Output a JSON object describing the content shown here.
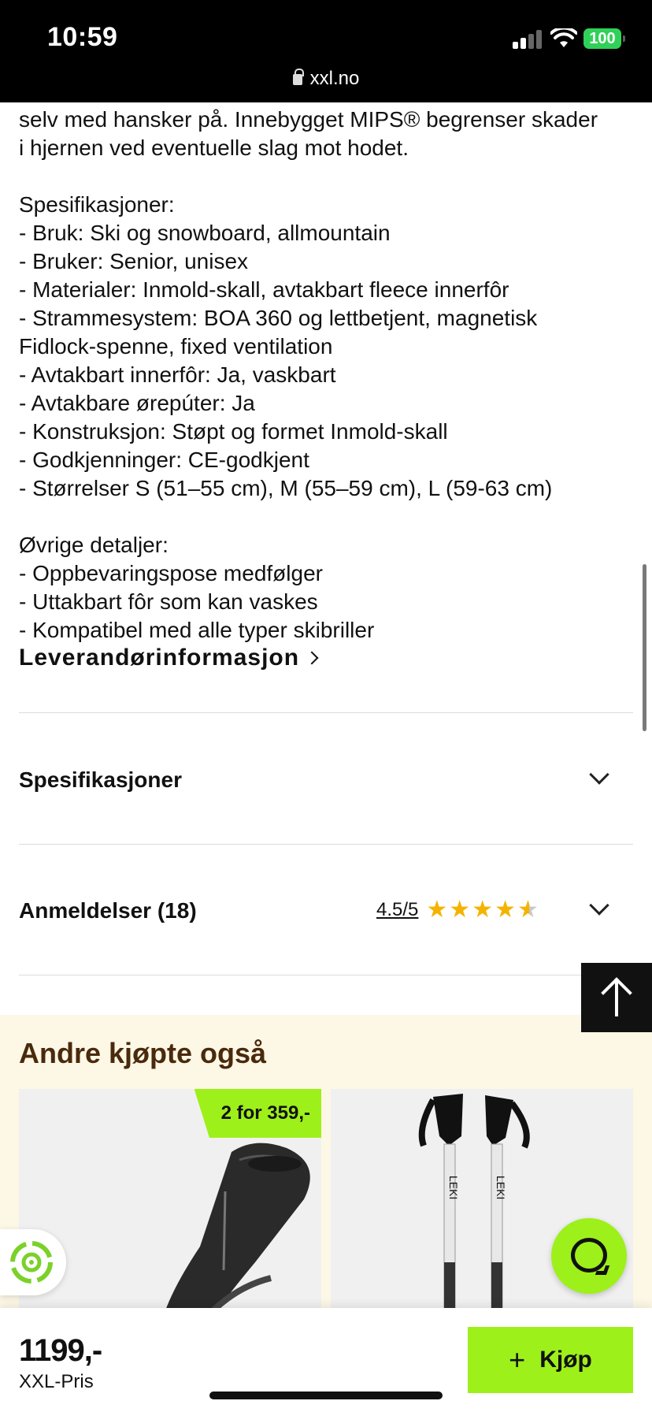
{
  "status_bar": {
    "time": "10:59",
    "url": "xxl.no",
    "battery": "100"
  },
  "description": {
    "lines_intro": [
      "selv med hansker på. Innebygget MIPS® begrenser skader",
      "i hjernen ved eventuelle slag mot hodet."
    ],
    "spec_heading": "Spesifikasjoner:",
    "spec_lines": [
      "- Bruk: Ski og snowboard, allmountain",
      "- Bruker: Senior, unisex",
      "- Materialer: Inmold-skall, avtakbart fleece innerfôr",
      "- Strammesystem: BOA 360 og lettbetjent, magnetisk",
      "Fidlock-spenne, fixed ventilation",
      "- Avtakbart innerfôr: Ja, vaskbart",
      "- Avtakbare ørepúter: Ja",
      "- Konstruksjon: Støpt og formet Inmold-skall",
      "- Godkjenninger: CE-godkjent",
      "- Størrelser S (51–55 cm), M (55–59 cm), L (59-63 cm)"
    ],
    "other_heading": "Øvrige detaljer:",
    "other_lines": [
      "- Oppbevaringspose medfølger",
      "- Uttakbart fôr som kan vaskes",
      "- Kompatibel med alle typer skibriller"
    ],
    "supplier_link": "Leverandørinformasjon"
  },
  "accordions": {
    "specs_label": "Spesifikasjoner",
    "reviews_label": "Anmeldelser (18)",
    "rating_text": "4.5/5",
    "rating_value": 4.5
  },
  "recommendations": {
    "title": "Andre kjøpte også",
    "card1_badge": "2 for 359,-"
  },
  "bottom_bar": {
    "price": "1199,-",
    "price_label": "XXL-Pris",
    "buy_label": "Kjøp"
  },
  "colors": {
    "accent_green": "#9ef01a",
    "reco_bg": "#fdf7e6",
    "reco_title": "#4a2a0c",
    "star": "#f5b301"
  }
}
